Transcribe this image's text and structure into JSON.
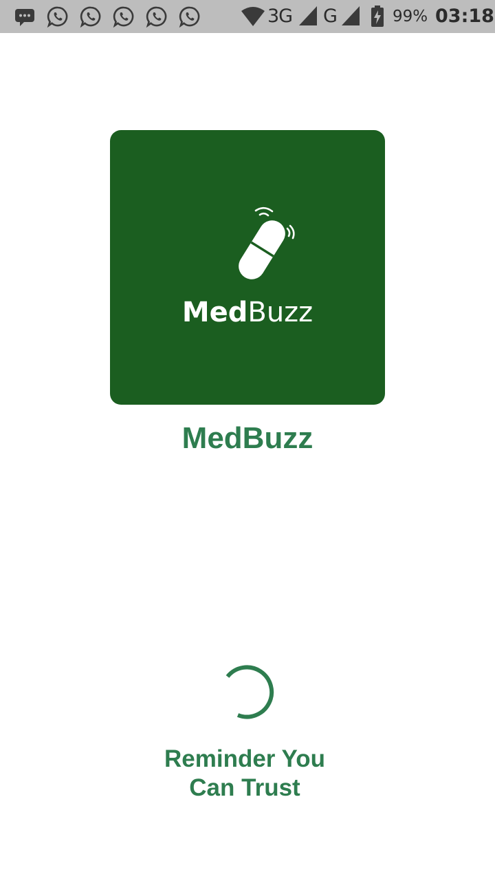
{
  "status_bar": {
    "background": "#bdbdbd",
    "notification_icons": [
      "messages-icon",
      "whatsapp-icon",
      "whatsapp-icon",
      "whatsapp-icon",
      "whatsapp-icon",
      "whatsapp-icon"
    ],
    "network_primary": "3G",
    "network_secondary": "G",
    "battery_percent": "99%",
    "time": "03:18"
  },
  "splash": {
    "logo": {
      "background": "#1b5e20",
      "icon": "pill-vibrating-icon",
      "wordmark_bold": "Med",
      "wordmark_light": "Buzz"
    },
    "app_title": "MedBuzz",
    "loading_indicator": "spinner",
    "tagline_line1": "Reminder You",
    "tagline_line2": "Can Trust"
  },
  "colors": {
    "brand_dark_green": "#1b5e20",
    "accent_green": "#2e7d4f",
    "status_text": "#2b2b2b"
  }
}
